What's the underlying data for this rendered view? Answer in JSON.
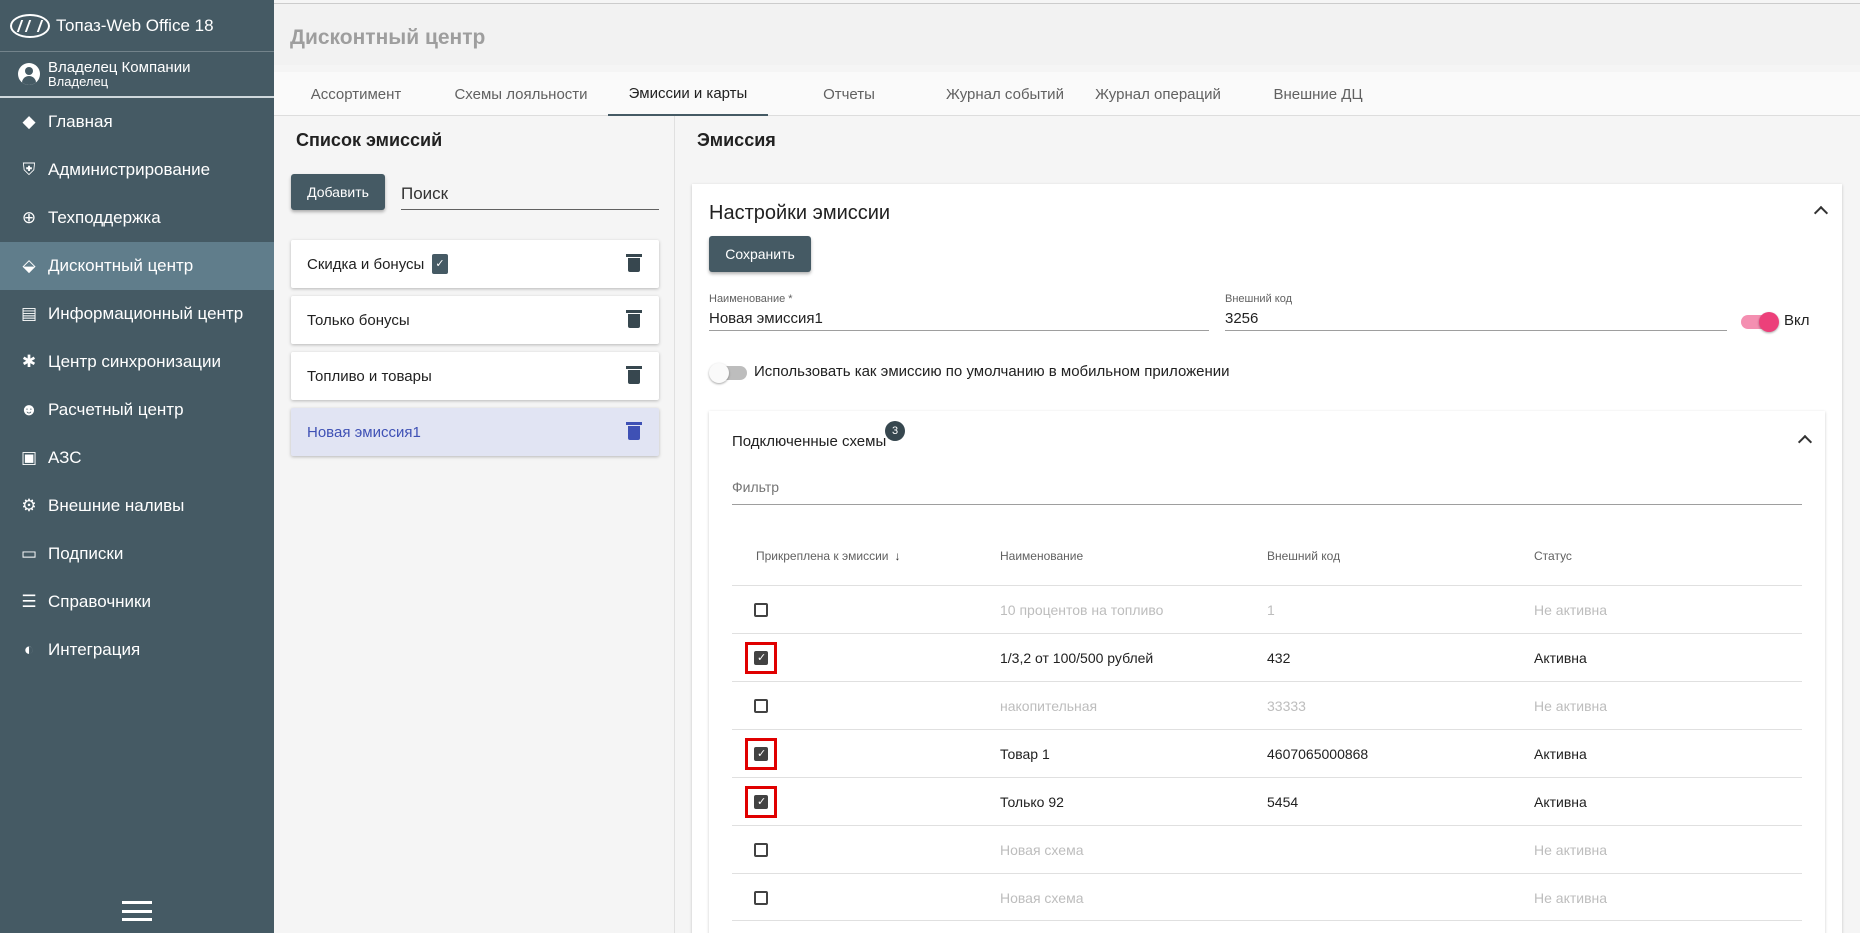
{
  "app": {
    "title": "Топаз-Web Office 18"
  },
  "user": {
    "name": "Владелец Компании",
    "role": "Владелец"
  },
  "nav": [
    {
      "label": "Главная",
      "icon": "diamond-icon"
    },
    {
      "label": "Администрирование",
      "icon": "admin-shield-icon"
    },
    {
      "label": "Техподдержка",
      "icon": "support-lifebuoy-icon"
    },
    {
      "label": "Дисконтный центр",
      "icon": "tag-icon",
      "active": true
    },
    {
      "label": "Информационный центр",
      "icon": "document-icon"
    },
    {
      "label": "Центр синхронизации",
      "icon": "sync-hub-icon"
    },
    {
      "label": "Расчетный центр",
      "icon": "people-icon"
    },
    {
      "label": "АЗС",
      "icon": "fuel-pump-icon"
    },
    {
      "label": "Внешние наливы",
      "icon": "gears-icon"
    },
    {
      "label": "Подписки",
      "icon": "subscription-icon"
    },
    {
      "label": "Справочники",
      "icon": "book-list-icon"
    },
    {
      "label": "Интеграция",
      "icon": "integration-icon"
    }
  ],
  "page": {
    "title": "Дисконтный центр"
  },
  "tabs": [
    "Ассортимент",
    "Схемы лояльности",
    "Эмиссии и карты",
    "Отчеты",
    "Журнал событий",
    "Журнал операций",
    "Внешние ДЦ"
  ],
  "active_tab": "Эмиссии и карты",
  "emissions_list": {
    "title": "Список эмиссий",
    "add_label": "Добавить",
    "search_placeholder": "Поиск",
    "items": [
      {
        "name": "Скидка и бонусы",
        "badge": true
      },
      {
        "name": "Только бонусы"
      },
      {
        "name": "Топливо и товары"
      },
      {
        "name": "Новая эмиссия1",
        "selected": true
      }
    ]
  },
  "emission": {
    "panel_title": "Эмиссия",
    "settings_title": "Настройки эмиссии",
    "save_label": "Сохранить",
    "name_label": "Наименование *",
    "name_value": "Новая эмиссия1",
    "code_label": "Внешний код",
    "code_value": "3256",
    "enabled_label": "Вкл",
    "enabled": true,
    "mobile_default_label": "Использовать как эмиссию по умолчанию в мобильном приложении",
    "mobile_default": false
  },
  "schemes": {
    "title": "Подключенные схемы",
    "count": "3",
    "filter_placeholder": "Фильтр",
    "headers": {
      "attached": "Прикреплена к эмиссии",
      "name": "Наименование",
      "code": "Внешний код",
      "status": "Статус"
    },
    "rows": [
      {
        "checked": false,
        "name": "10 процентов на топливо",
        "code": "1",
        "status": "Не активна"
      },
      {
        "checked": true,
        "name": "1/3,2 от 100/500 рублей",
        "code": "432",
        "status": "Активна"
      },
      {
        "checked": false,
        "name": "накопительная",
        "code": "33333",
        "status": "Не активна"
      },
      {
        "checked": true,
        "name": "Товар 1",
        "code": "4607065000868",
        "status": "Активна"
      },
      {
        "checked": true,
        "name": "Только 92",
        "code": "5454",
        "status": "Активна"
      },
      {
        "checked": false,
        "name": "Новая схема",
        "code": "",
        "status": "Не активна"
      },
      {
        "checked": false,
        "name": "Новая схема",
        "code": "",
        "status": "Не активна"
      }
    ]
  },
  "colors": {
    "sidebar": "#455a64",
    "sidebar_active": "#607d8b",
    "toggle_on": "#ec407a",
    "highlight": "#e00000"
  }
}
